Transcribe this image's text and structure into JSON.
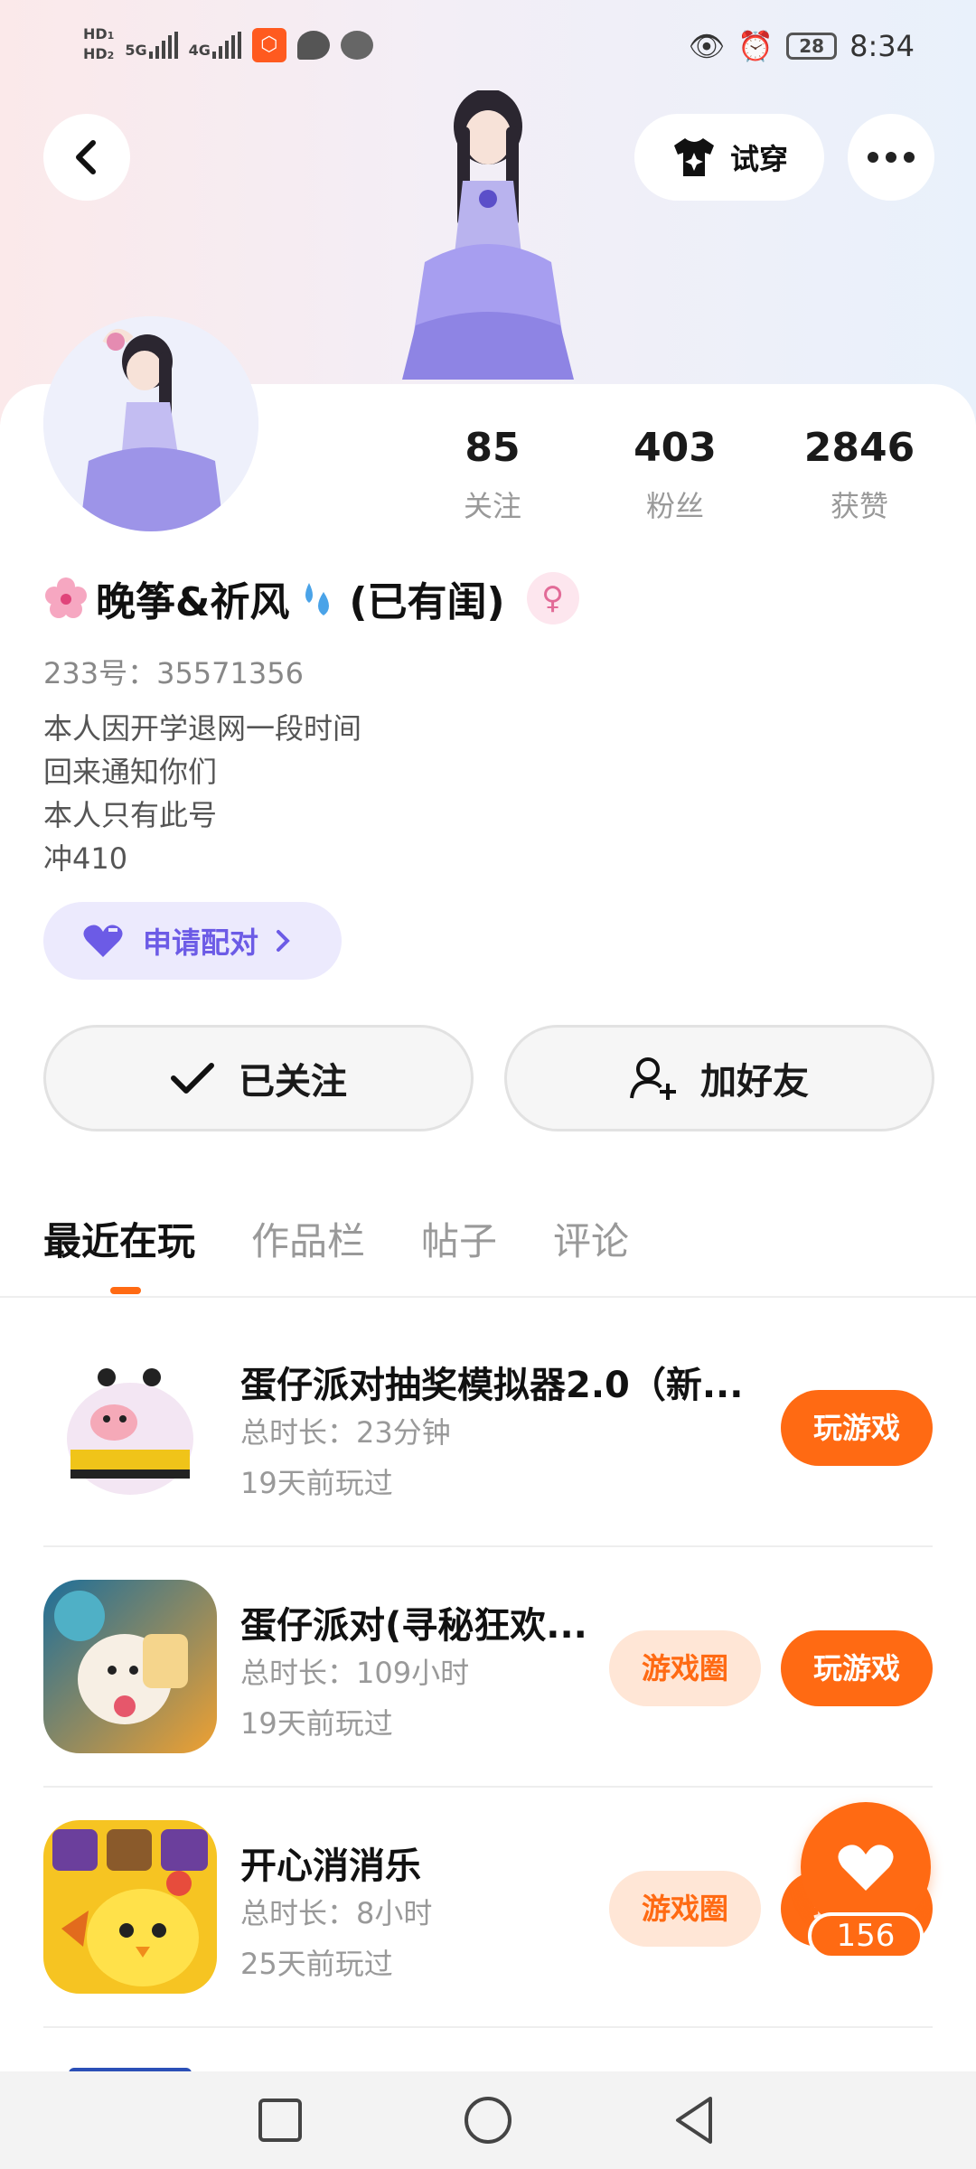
{
  "status_bar": {
    "hd1": "HD",
    "hd1_sub": "1",
    "hd2": "HD",
    "hd2_sub": "2",
    "net1": "5G",
    "net2": "4G",
    "battery": "28",
    "time": "8:34"
  },
  "header": {
    "try_on_label": "试穿"
  },
  "profile": {
    "stats": [
      {
        "value": "85",
        "label": "关注"
      },
      {
        "value": "403",
        "label": "粉丝"
      },
      {
        "value": "2846",
        "label": "获赞"
      }
    ],
    "nickname": "晚筝&祈风",
    "nickname_suffix": "(已有闺)",
    "gender_symbol": "♀",
    "uid": "233号：35571356",
    "bio": [
      "本人因开学退网一段时间",
      "回来通知你们",
      "本人只有此号",
      "冲410"
    ],
    "pair_label": "申请配对",
    "follow_label": "已关注",
    "add_friend_label": "加好友"
  },
  "tabs": [
    "最近在玩",
    "作品栏",
    "帖子",
    "评论"
  ],
  "games": [
    {
      "title": "蛋仔派对抽奖模拟器2.0（新...",
      "duration": "总时长：23分钟",
      "last_played": "19天前玩过",
      "play_label": "玩游戏",
      "circle_label": ""
    },
    {
      "title": "蛋仔派对(寻秘狂欢...",
      "duration": "总时长：109小时",
      "last_played": "19天前玩过",
      "play_label": "玩游戏",
      "circle_label": "游戏圈"
    },
    {
      "title": "开心消消乐",
      "duration": "总时长：8小时",
      "last_played": "25天前玩过",
      "play_label": "玩游戏",
      "circle_label": "游戏圈"
    }
  ],
  "like": {
    "count": "156"
  },
  "colors": {
    "accent": "#ff6a13",
    "pair_accent": "#6c5be6"
  }
}
